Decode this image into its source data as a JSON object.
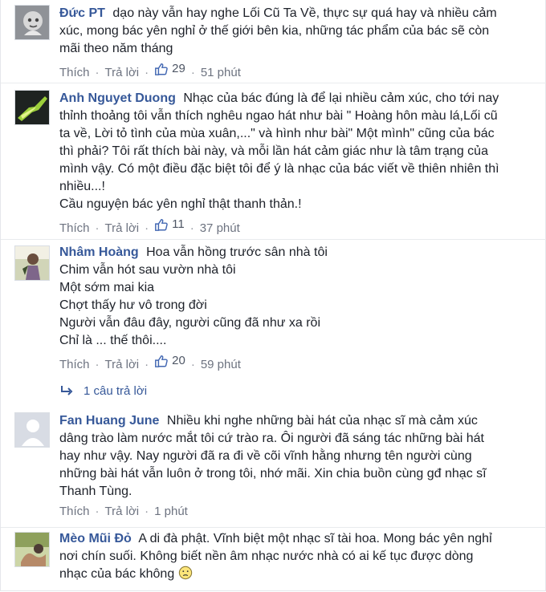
{
  "actions": {
    "like": "Thích",
    "reply": "Trả lời"
  },
  "comments": [
    {
      "author": "Đức PT",
      "lines": [
        "dạo này vẫn hay nghe Lối Cũ Ta Về, thực sự quá hay và nhiều cảm",
        "xúc, mong bác yên nghỉ ở thế giới bên kia, những tác phẩm của bác sẽ còn",
        "mãi theo năm tháng"
      ],
      "likes": "29",
      "time": "51 phút"
    },
    {
      "author": "Anh Nguyet Duong",
      "lines": [
        "Nhạc của bác đúng là để lại nhiều cảm xúc, cho tới nay",
        "thỉnh thoảng tôi vẫn thích nghêu ngao hát như bài \" Hoàng hôn màu lá,Lối cũ",
        "ta về, Lời tỏ tình của mùa xuân,...\" và hình như bài\" Một mình\" cũng của bác",
        "thì phải? Tôi rất thích bài này, và mỗi lần hát cảm giác như là tâm trạng của",
        "mình vậy. Có một điều đặc biệt tôi để ý là nhạc của bác viết về thiên nhiên thì",
        "nhiều...!",
        "Cầu nguyện bác yên nghỉ thật thanh thản.!"
      ],
      "likes": "11",
      "time": "37 phút"
    },
    {
      "author": "Nhâm Hoàng",
      "lines": [
        "Hoa vẫn hồng trước sân nhà tôi",
        "Chim vẫn hót sau vườn nhà tôi",
        "Một sớm mai kia",
        "Chợt thấy hư vô trong đời",
        "Người vẫn đâu đây, người cũng đã như xa rồi",
        "Chỉ là ... thế thôi...."
      ],
      "likes": "20",
      "time": "59 phút",
      "replies": "1 câu trả lời"
    },
    {
      "author": "Fan Huang June",
      "lines": [
        "Nhiều khi nghe những bài hát của nhạc sĩ mà cảm xúc",
        "dâng trào làm nước mắt tôi cứ trào ra. Ôi người đã sáng tác những bài hát",
        "hay như vậy. Nay người đã ra đi về cõi vĩnh hằng nhưng tên người cùng",
        "những bài hát vẫn luôn ở trong tôi, nhớ mãi. Xin chia buồn cùng gđ nhạc sĩ",
        "Thanh Tùng."
      ],
      "time": "1 phút"
    },
    {
      "author": "Mèo Mũi Đỏ",
      "lines": [
        "A di đà phật. Vĩnh biệt một nhạc sĩ tài hoa. Mong bác yên nghỉ",
        "nơi chín suối. Không biết nền âm nhạc nước nhà có ai kế tục được dòng",
        "nhạc của bác không"
      ]
    }
  ],
  "icons": {
    "thumbs_up": "thumbs-up-icon",
    "reply_arrow": "reply-arrow-icon",
    "sad_face": "sad-face-emoji-icon"
  }
}
